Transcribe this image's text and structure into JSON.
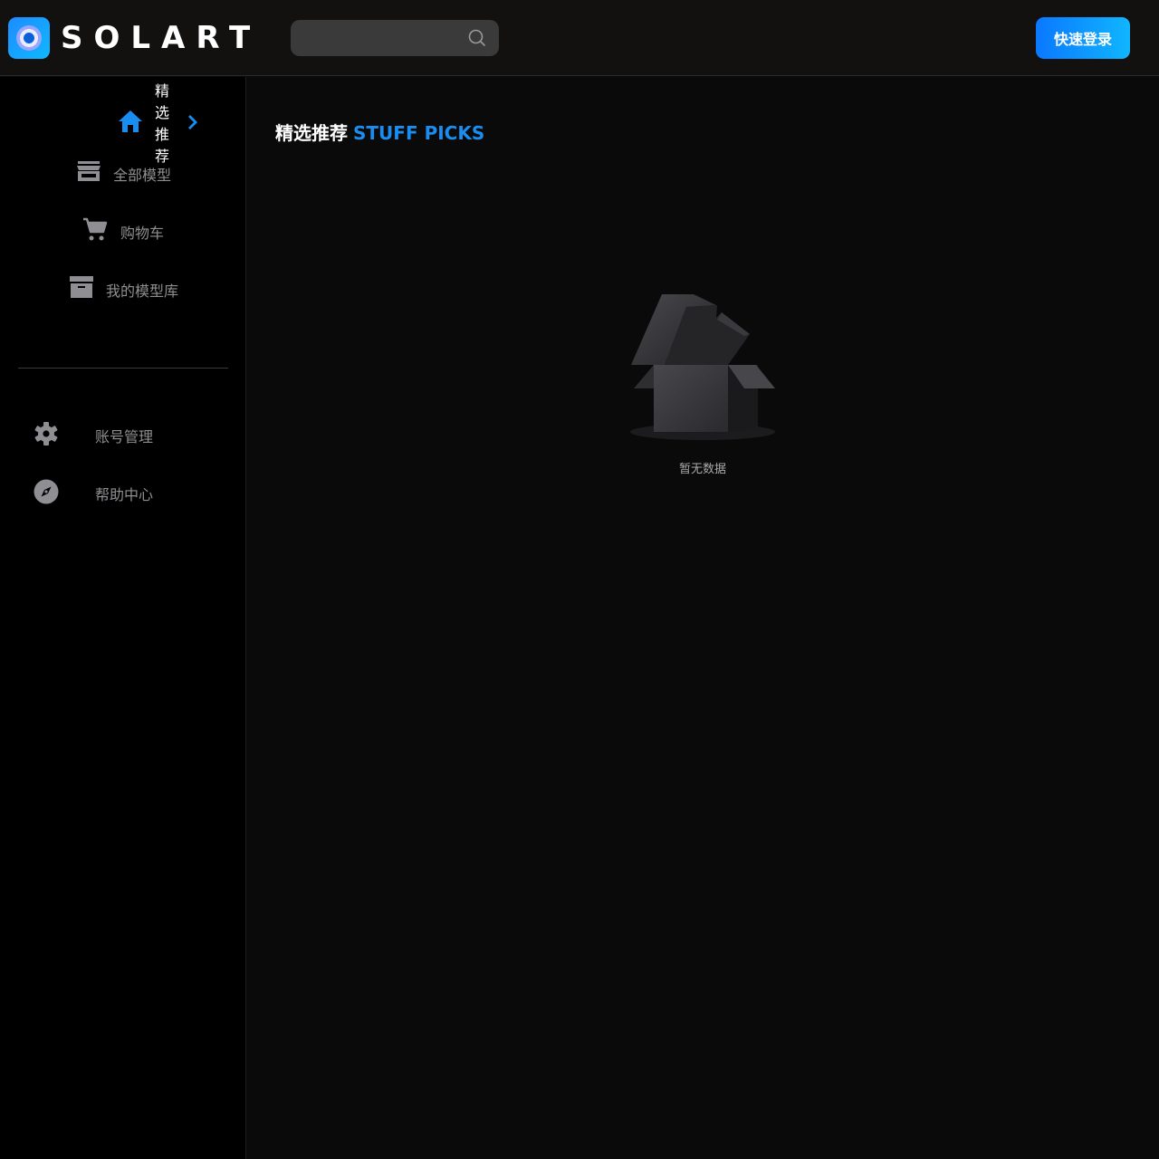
{
  "header": {
    "logo_text": "SOLART",
    "search": {
      "placeholder": "",
      "value": ""
    },
    "login_label": "快速登录"
  },
  "sidebar": {
    "items": [
      {
        "label": "精选推荐",
        "icon": "home-icon",
        "active": true
      },
      {
        "label": "全部模型",
        "icon": "store-icon"
      },
      {
        "label": "购物车",
        "icon": "cart-icon"
      },
      {
        "label": "我的模型库",
        "icon": "archive-icon"
      }
    ],
    "secondary": [
      {
        "label": "账号管理",
        "icon": "gear-icon"
      },
      {
        "label": "帮助中心",
        "icon": "compass-icon"
      }
    ]
  },
  "main": {
    "title_zh": "精选推荐",
    "title_en": "STUFF PICKS",
    "empty_text": "暂无数据"
  },
  "colors": {
    "accent": "#1a8df0",
    "header_bg": "#121110",
    "sidebar_bg": "#000000",
    "main_bg": "#0a0a0a",
    "muted_text": "#8f8f93"
  }
}
